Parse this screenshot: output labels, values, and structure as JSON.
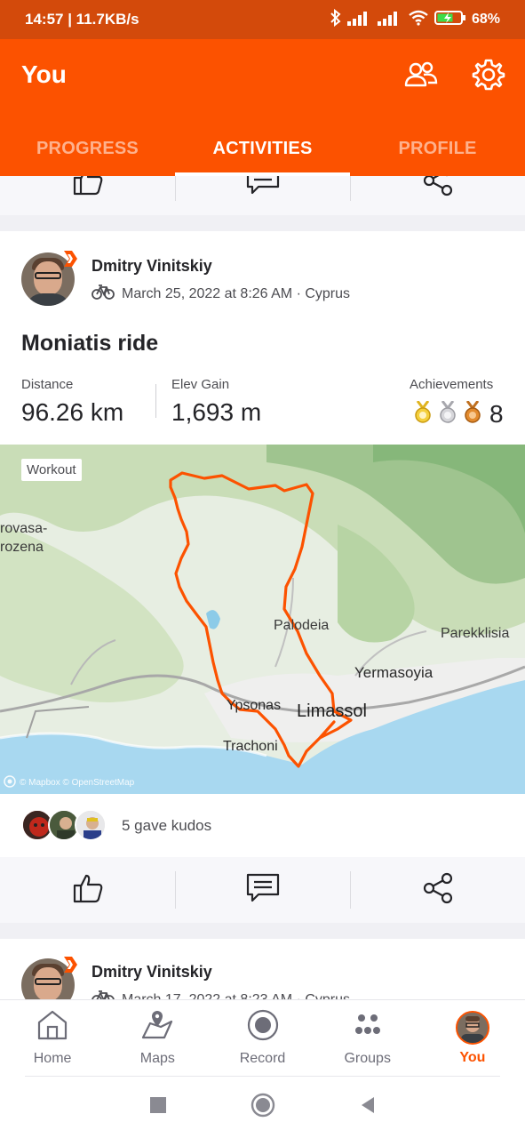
{
  "status_bar": {
    "time_speed": "14:57 | 11.7KB/s",
    "battery_percent": "68%"
  },
  "header": {
    "title": "You",
    "tabs": [
      {
        "label": "PROGRESS",
        "active": false
      },
      {
        "label": "ACTIVITIES",
        "active": true
      },
      {
        "label": "PROFILE",
        "active": false
      }
    ]
  },
  "activity": {
    "athlete_name": "Dmitry Vinitskiy",
    "meta": "March 25, 2022 at 8:26 AM · Cyprus",
    "title": "Moniatis ride",
    "stats": {
      "distance_label": "Distance",
      "distance_value": "96.26 km",
      "elev_label": "Elev Gain",
      "elev_value": "1,693 m",
      "achievements_label": "Achievements",
      "achievements_value": "8"
    },
    "map": {
      "tag": "Workout",
      "attribution": "© Mapbox © OpenStreetMap",
      "place_labels": {
        "rovasa": "rovasa-",
        "rozena": "rozena",
        "palodeia": "Palodeia",
        "parekklisia": "Parekklisia",
        "yermasoyia": "Yermasoyia",
        "ypsonas": "Ypsonas",
        "limassol": "Limassol",
        "trachoni": "Trachoni"
      }
    },
    "kudos_text": "5 gave kudos"
  },
  "next_activity": {
    "athlete_name": "Dmitry Vinitskiy",
    "meta": "March 17, 2022 at 8:23 AM · Cyprus"
  },
  "bottom_nav": [
    {
      "label": "Home",
      "icon": "home-icon"
    },
    {
      "label": "Maps",
      "icon": "maps-icon"
    },
    {
      "label": "Record",
      "icon": "record-icon"
    },
    {
      "label": "Groups",
      "icon": "groups-icon"
    },
    {
      "label": "You",
      "icon": "you-avatar",
      "active": true
    }
  ],
  "colors": {
    "brand": "#fc5200",
    "statusbar": "#d34a0b",
    "route": "#fc5200",
    "sea": "#a8d8f0"
  }
}
